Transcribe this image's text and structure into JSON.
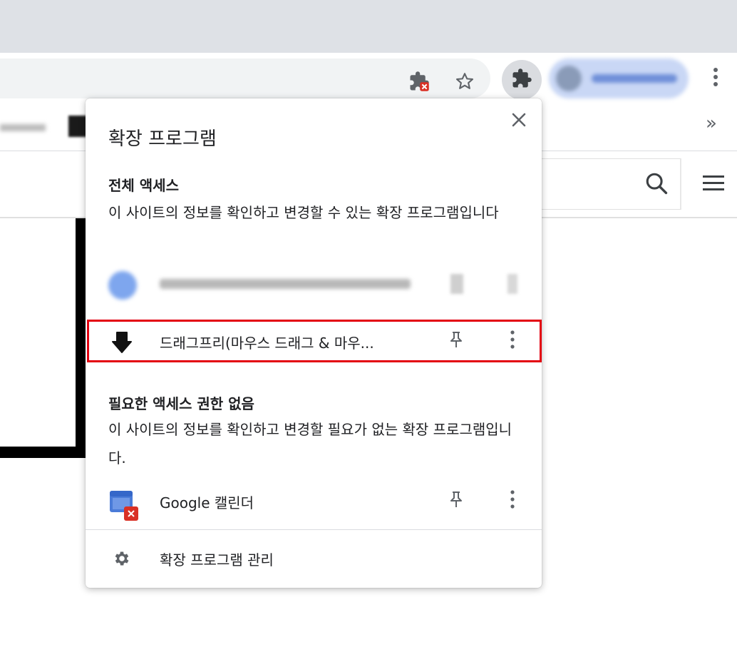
{
  "toolbar": {
    "extension_error_icon": "puzzle-with-error-icon",
    "bookmark_icon": "star-icon",
    "extensions_icon": "puzzle-icon",
    "menu_icon": "vertical-dots-icon"
  },
  "bookmarks": {
    "more_label": "»"
  },
  "page": {
    "search_icon": "search-icon",
    "menu_icon": "hamburger-icon"
  },
  "popup": {
    "title": "확장 프로그램",
    "close_icon": "close-icon",
    "full_access": {
      "heading": "전체 액세스",
      "description": "이 사이트의 정보를 확인하고 변경할 수 있는 확장 프로그램입니다",
      "items": [
        {
          "label": "",
          "icon": "blurred-extension-icon"
        },
        {
          "label": "드래그프리(마우스 드래그 & 마우...",
          "icon": "down-arrow-icon"
        }
      ]
    },
    "no_access": {
      "heading": "필요한 액세스 권한 없음",
      "description": "이 사이트의 정보를 확인하고 변경할 필요가 없는 확장 프로그램입니다.",
      "items": [
        {
          "label": "Google 캘린더",
          "icon": "google-calendar-icon"
        }
      ]
    },
    "manage_label": "확장 프로그램 관리",
    "manage_icon": "gear-icon"
  },
  "colors": {
    "highlight": "#e3000f",
    "tabstrip": "#dee1e6",
    "omnibox": "#f1f3f4",
    "icon_gray": "#5f6368"
  }
}
